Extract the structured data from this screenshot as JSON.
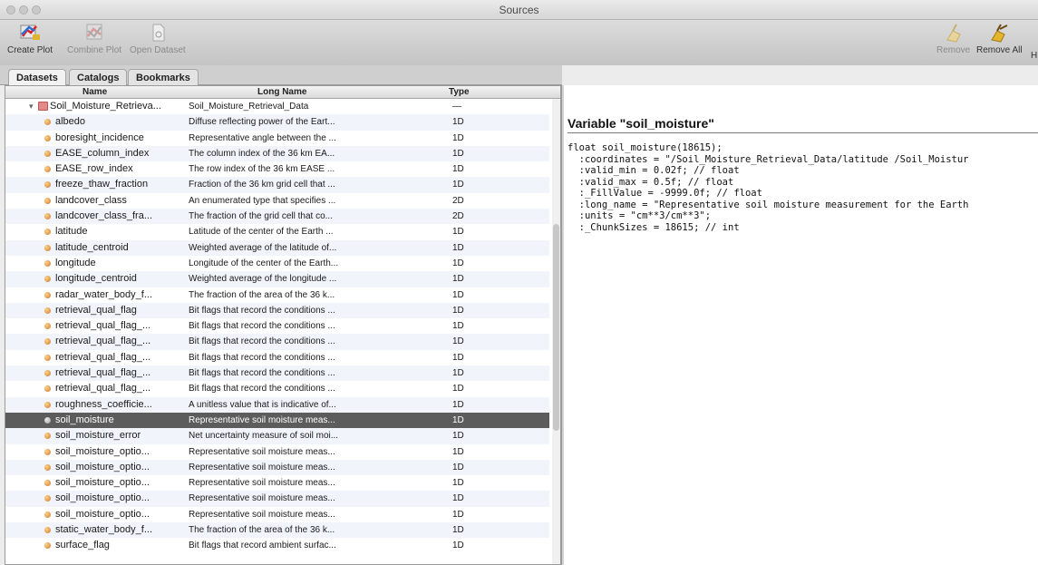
{
  "window": {
    "title": "Sources"
  },
  "toolbar": {
    "create_plot": "Create Plot",
    "combine_plot": "Combine Plot",
    "open_dataset": "Open Dataset",
    "remove": "Remove",
    "remove_all": "Remove All",
    "trailing": "H"
  },
  "tabs": [
    "Datasets",
    "Catalogs",
    "Bookmarks"
  ],
  "table": {
    "headers": {
      "name": "Name",
      "long_name": "Long Name",
      "type": "Type"
    },
    "rows": [
      {
        "name": "Soil_Moisture_Retrieva...",
        "long_name": "Soil_Moisture_Retrieval_Data",
        "type": "—",
        "group": true
      },
      {
        "name": "albedo",
        "long_name": "Diffuse reflecting power of the Eart...",
        "type": "1D"
      },
      {
        "name": "boresight_incidence",
        "long_name": "Representative angle between the ...",
        "type": "1D"
      },
      {
        "name": "EASE_column_index",
        "long_name": "The column index of the 36 km EA...",
        "type": "1D"
      },
      {
        "name": "EASE_row_index",
        "long_name": "The row index of the 36 km EASE ...",
        "type": "1D"
      },
      {
        "name": "freeze_thaw_fraction",
        "long_name": "Fraction of the 36 km grid cell that ...",
        "type": "1D"
      },
      {
        "name": "landcover_class",
        "long_name": "An enumerated type that specifies ...",
        "type": "2D"
      },
      {
        "name": "landcover_class_fra...",
        "long_name": "The fraction of the grid cell that co...",
        "type": "2D"
      },
      {
        "name": "latitude",
        "long_name": "Latitude of the center of the Earth ...",
        "type": "1D"
      },
      {
        "name": "latitude_centroid",
        "long_name": "Weighted average of the latitude of...",
        "type": "1D"
      },
      {
        "name": "longitude",
        "long_name": "Longitude of the center of the Earth...",
        "type": "1D"
      },
      {
        "name": "longitude_centroid",
        "long_name": "Weighted average of the longitude ...",
        "type": "1D"
      },
      {
        "name": "radar_water_body_f...",
        "long_name": "The fraction of the area of the 36 k...",
        "type": "1D"
      },
      {
        "name": "retrieval_qual_flag",
        "long_name": "Bit flags that record the conditions ...",
        "type": "1D"
      },
      {
        "name": "retrieval_qual_flag_...",
        "long_name": "Bit flags that record the conditions ...",
        "type": "1D"
      },
      {
        "name": "retrieval_qual_flag_...",
        "long_name": "Bit flags that record the conditions ...",
        "type": "1D"
      },
      {
        "name": "retrieval_qual_flag_...",
        "long_name": "Bit flags that record the conditions ...",
        "type": "1D"
      },
      {
        "name": "retrieval_qual_flag_...",
        "long_name": "Bit flags that record the conditions ...",
        "type": "1D"
      },
      {
        "name": "retrieval_qual_flag_...",
        "long_name": "Bit flags that record the conditions ...",
        "type": "1D"
      },
      {
        "name": "roughness_coefficie...",
        "long_name": "A unitless value that is indicative of...",
        "type": "1D"
      },
      {
        "name": "soil_moisture",
        "long_name": "Representative soil moisture meas...",
        "type": "1D",
        "selected": true
      },
      {
        "name": "soil_moisture_error",
        "long_name": "Net uncertainty measure of soil moi...",
        "type": "1D"
      },
      {
        "name": "soil_moisture_optio...",
        "long_name": "Representative soil moisture meas...",
        "type": "1D"
      },
      {
        "name": "soil_moisture_optio...",
        "long_name": "Representative soil moisture meas...",
        "type": "1D"
      },
      {
        "name": "soil_moisture_optio...",
        "long_name": "Representative soil moisture meas...",
        "type": "1D"
      },
      {
        "name": "soil_moisture_optio...",
        "long_name": "Representative soil moisture meas...",
        "type": "1D"
      },
      {
        "name": "soil_moisture_optio...",
        "long_name": "Representative soil moisture meas...",
        "type": "1D"
      },
      {
        "name": "static_water_body_f...",
        "long_name": "The fraction of the area of the 36 k...",
        "type": "1D"
      },
      {
        "name": "surface_flag",
        "long_name": "Bit flags that record ambient surfac...",
        "type": "1D"
      }
    ]
  },
  "detail": {
    "title": "Variable \"soil_moisture\"",
    "lines": [
      "float soil_moisture(18615);",
      "  :coordinates = \"/Soil_Moisture_Retrieval_Data/latitude /Soil_Moistur",
      "  :valid_min = 0.02f; // float",
      "  :valid_max = 0.5f; // float",
      "  :_FillValue = -9999.0f; // float",
      "  :long_name = \"Representative soil moisture measurement for the Earth",
      "  :units = \"cm**3/cm**3\";",
      "  :_ChunkSizes = 18615; // int"
    ]
  },
  "colors": {
    "selected_row": "#5c5c5c",
    "alt_row": "#f1f5fb"
  }
}
